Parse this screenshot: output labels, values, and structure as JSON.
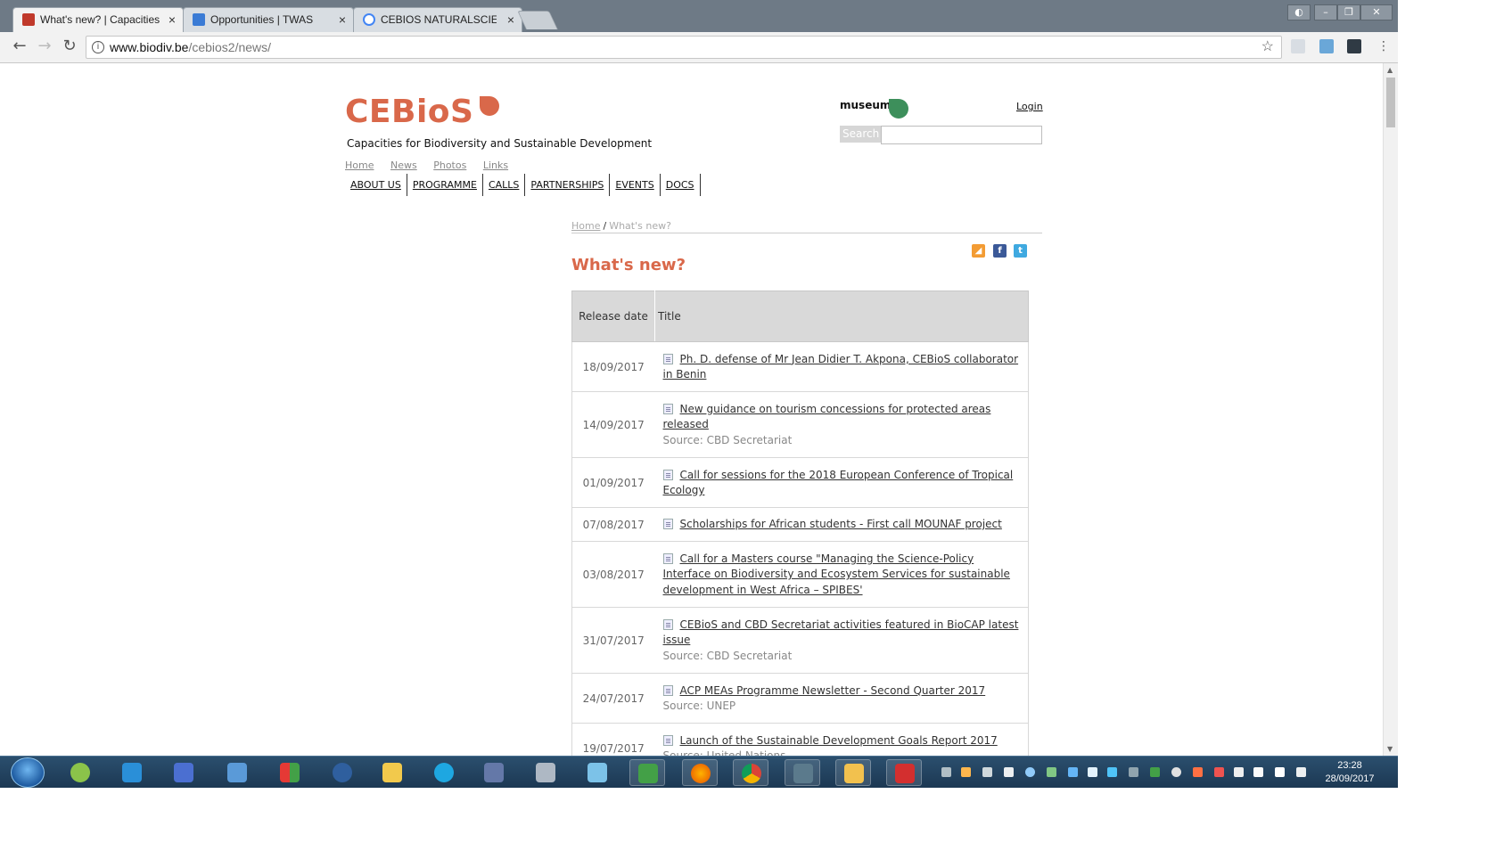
{
  "browser": {
    "tabs": [
      {
        "title": "What's new? | Capacities",
        "active": true
      },
      {
        "title": "Opportunities | TWAS",
        "active": false
      },
      {
        "title": "CEBIOS NATURALSCIENC",
        "active": false
      }
    ],
    "url_domain": "www.biodiv.be",
    "url_path": "/cebios2/news/",
    "info_glyph": "i",
    "star_glyph": "☆"
  },
  "site": {
    "logo_text": "CEBioS",
    "tagline": "Capacities for Biodiversity and Sustainable Development",
    "partner_logo_text": "museum",
    "login": "Login",
    "search_label": "Search",
    "search_value": "",
    "util_nav": [
      "Home",
      "News",
      "Photos",
      "Links"
    ],
    "main_nav": [
      "ABOUT US",
      "PROGRAMME",
      "CALLS",
      "PARTNERSHIPS",
      "EVENTS",
      "DOCS"
    ],
    "brand_color": "#d9684a"
  },
  "page": {
    "breadcrumb": [
      "Home",
      "What's new?"
    ],
    "breadcrumb_sep": "/",
    "title": "What's new?",
    "table_headers": {
      "date": "Release date",
      "title": "Title"
    },
    "news": [
      {
        "date": "18/09/2017",
        "title": "Ph. D. defense of Mr Jean Didier T. Akpona, CEBioS collaborator in Benin",
        "source": ""
      },
      {
        "date": "14/09/2017",
        "title": "New guidance on tourism concessions for protected areas released",
        "source": "Source: CBD Secretariat"
      },
      {
        "date": "01/09/2017",
        "title": "Call for sessions for the 2018 European Conference of Tropical Ecology",
        "source": ""
      },
      {
        "date": "07/08/2017",
        "title": "Scholarships for African students - First call MOUNAF project",
        "source": ""
      },
      {
        "date": "03/08/2017",
        "title": "Call for a Masters course \"Managing the Science-Policy Interface on Biodiversity and Ecosystem Services for sustainable development in West Africa – SPIBES'",
        "source": ""
      },
      {
        "date": "31/07/2017",
        "title": "CEBioS and CBD Secretariat activities featured in BioCAP latest issue",
        "source": "Source: CBD Secretariat"
      },
      {
        "date": "24/07/2017",
        "title": "ACP MEAs Programme Newsletter - Second Quarter 2017",
        "source": "Source: UNEP"
      },
      {
        "date": "19/07/2017",
        "title": "Launch of the Sustainable Development Goals Report 2017",
        "source": "Source: United Nations"
      }
    ]
  },
  "taskbar": {
    "time": "23:28",
    "date": "28/09/2017",
    "icons": [
      "qgis-icon",
      "app-icon",
      "network-icon",
      "folder-app-icon",
      "grid-app-icon",
      "thunderbird-icon",
      "mail-icon",
      "search-app-icon",
      "chart-app-icon",
      "calculator-icon",
      "notepad-icon",
      "green-app-icon",
      "firefox-icon",
      "chrome-icon",
      "monitor-icon",
      "explorer-icon",
      "acrobat-icon"
    ]
  }
}
